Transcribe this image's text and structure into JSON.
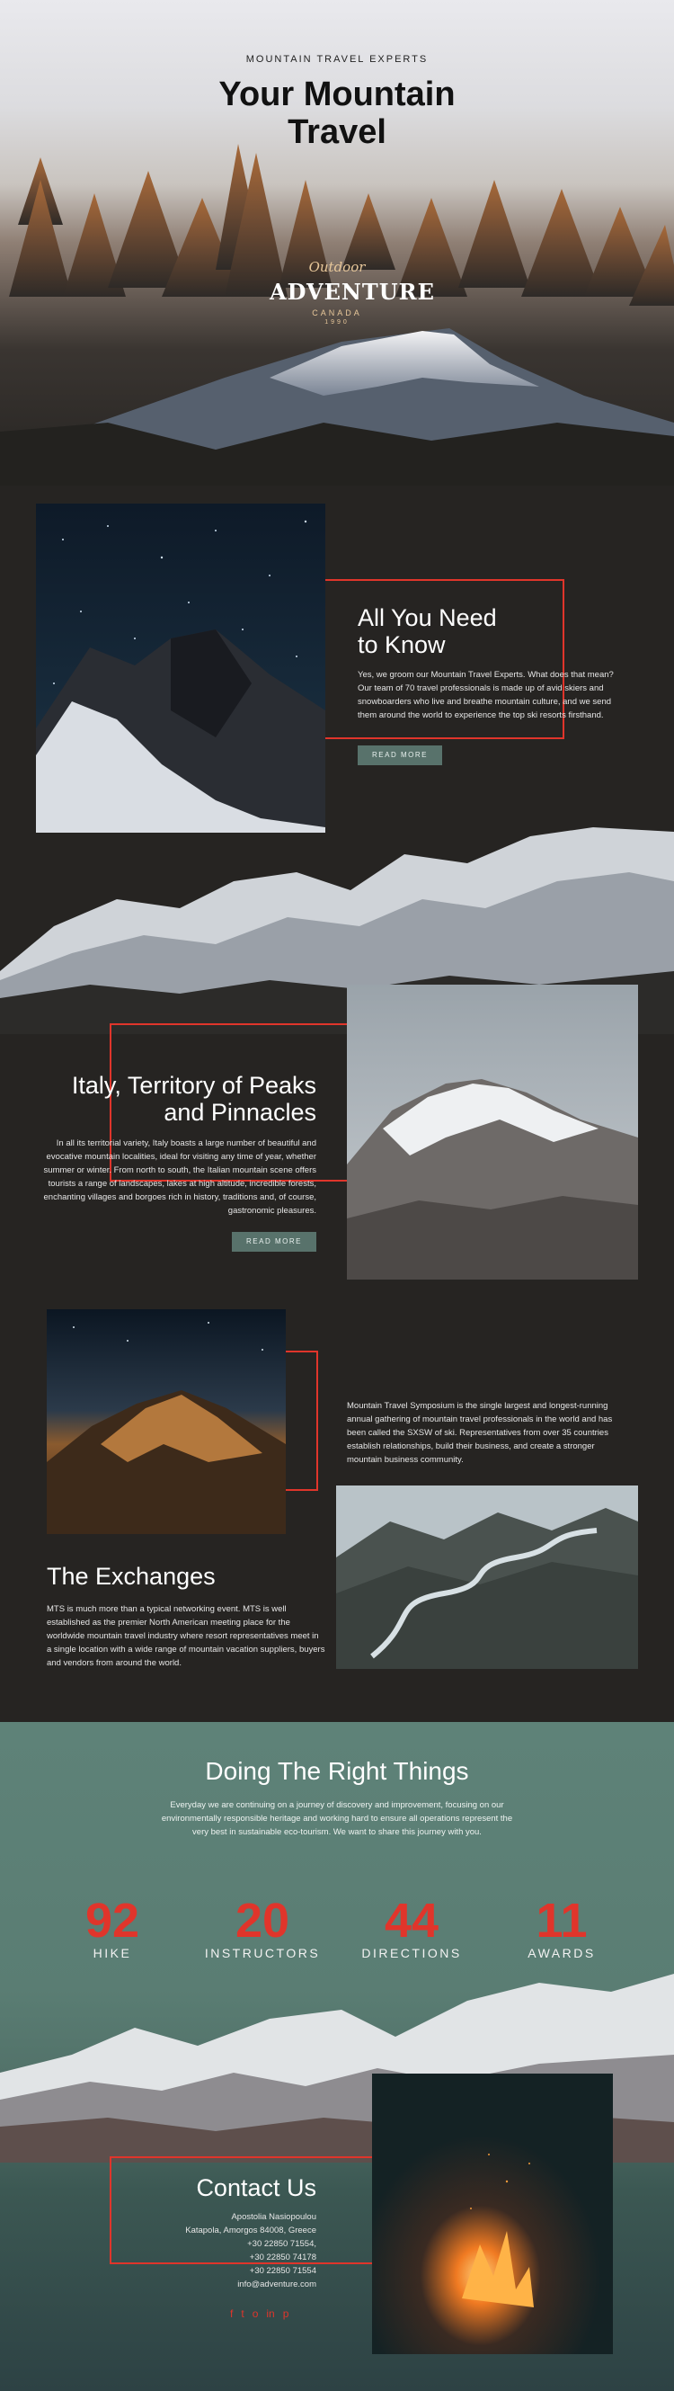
{
  "hero": {
    "kicker": "MOUNTAIN TRAVEL EXPERTS",
    "title_line1": "Your Mountain",
    "title_line2": "Travel",
    "badge_script": "Outdoor",
    "badge_main": "ADVENTURE",
    "badge_country": "CANADA",
    "badge_year": "1990"
  },
  "know": {
    "title_line1": "All You Need",
    "title_line2": "to Know",
    "text": "Yes, we groom our Mountain Travel Experts. What does that mean? Our team of 70 travel professionals is made up of avid skiers and snowboarders who live and breathe mountain culture, and we send them around the world to experience the top ski resorts firsthand.",
    "button": "READ MORE"
  },
  "italy": {
    "title_line1": "Italy, Territory of Peaks",
    "title_line2": "and Pinnacles",
    "text": "In all its territorial variety, Italy boasts a large number of beautiful and evocative mountain localities, ideal for visiting any time of year, whether summer or winter. From north to south, the Italian mountain scene offers tourists a range of landscapes, lakes at high altitude, incredible forests, enchanting villages and borgoes rich in history, traditions and, of course, gastronomic pleasures.",
    "button": "READ MORE"
  },
  "exchanges": {
    "side_text": "Mountain Travel Symposium is the single largest and longest-running annual gathering of mountain travel professionals in the world and has been called the SXSW of ski. Representatives from over 35 countries establish relationships, build their business, and create a stronger mountain business community.",
    "title": "The Exchanges",
    "text": "MTS is much more than a typical networking event. MTS is well established as the premier North American meeting place for the worldwide mountain travel industry where resort representatives meet in a single location with a wide range of mountain vacation suppliers, buyers and vendors from around the world."
  },
  "right_things": {
    "title": "Doing The Right Things",
    "text": "Everyday we are continuing on a journey of discovery and improvement, focusing on our environmentally responsible heritage and working hard to ensure all operations represent the very best in sustainable eco-tourism. We want to share this journey with you."
  },
  "stats": [
    {
      "number": "92",
      "label": "HIKE"
    },
    {
      "number": "20",
      "label": "INSTRUCTORS"
    },
    {
      "number": "44",
      "label": "DIRECTIONS"
    },
    {
      "number": "11",
      "label": "AWARDS"
    }
  ],
  "contact": {
    "title": "Contact Us",
    "name": "Apostolia Nasiopoulou",
    "address": "Katapola, Amorgos 84008, Greece",
    "phone1": "+30 22850 71554,",
    "phone2": "+30 22850 74178",
    "phone3": "+30 22850 71554",
    "email": "info@adventure.com",
    "social": [
      "f",
      "t",
      "o",
      "in",
      "p"
    ]
  },
  "colors": {
    "accent_red": "#e0352b",
    "button_teal": "#58726b",
    "dark_bg": "#262422",
    "section_teal": "#5a7d73"
  },
  "icons": [
    "facebook-icon",
    "twitter-icon",
    "instagram-icon",
    "linkedin-icon",
    "pinterest-icon"
  ]
}
